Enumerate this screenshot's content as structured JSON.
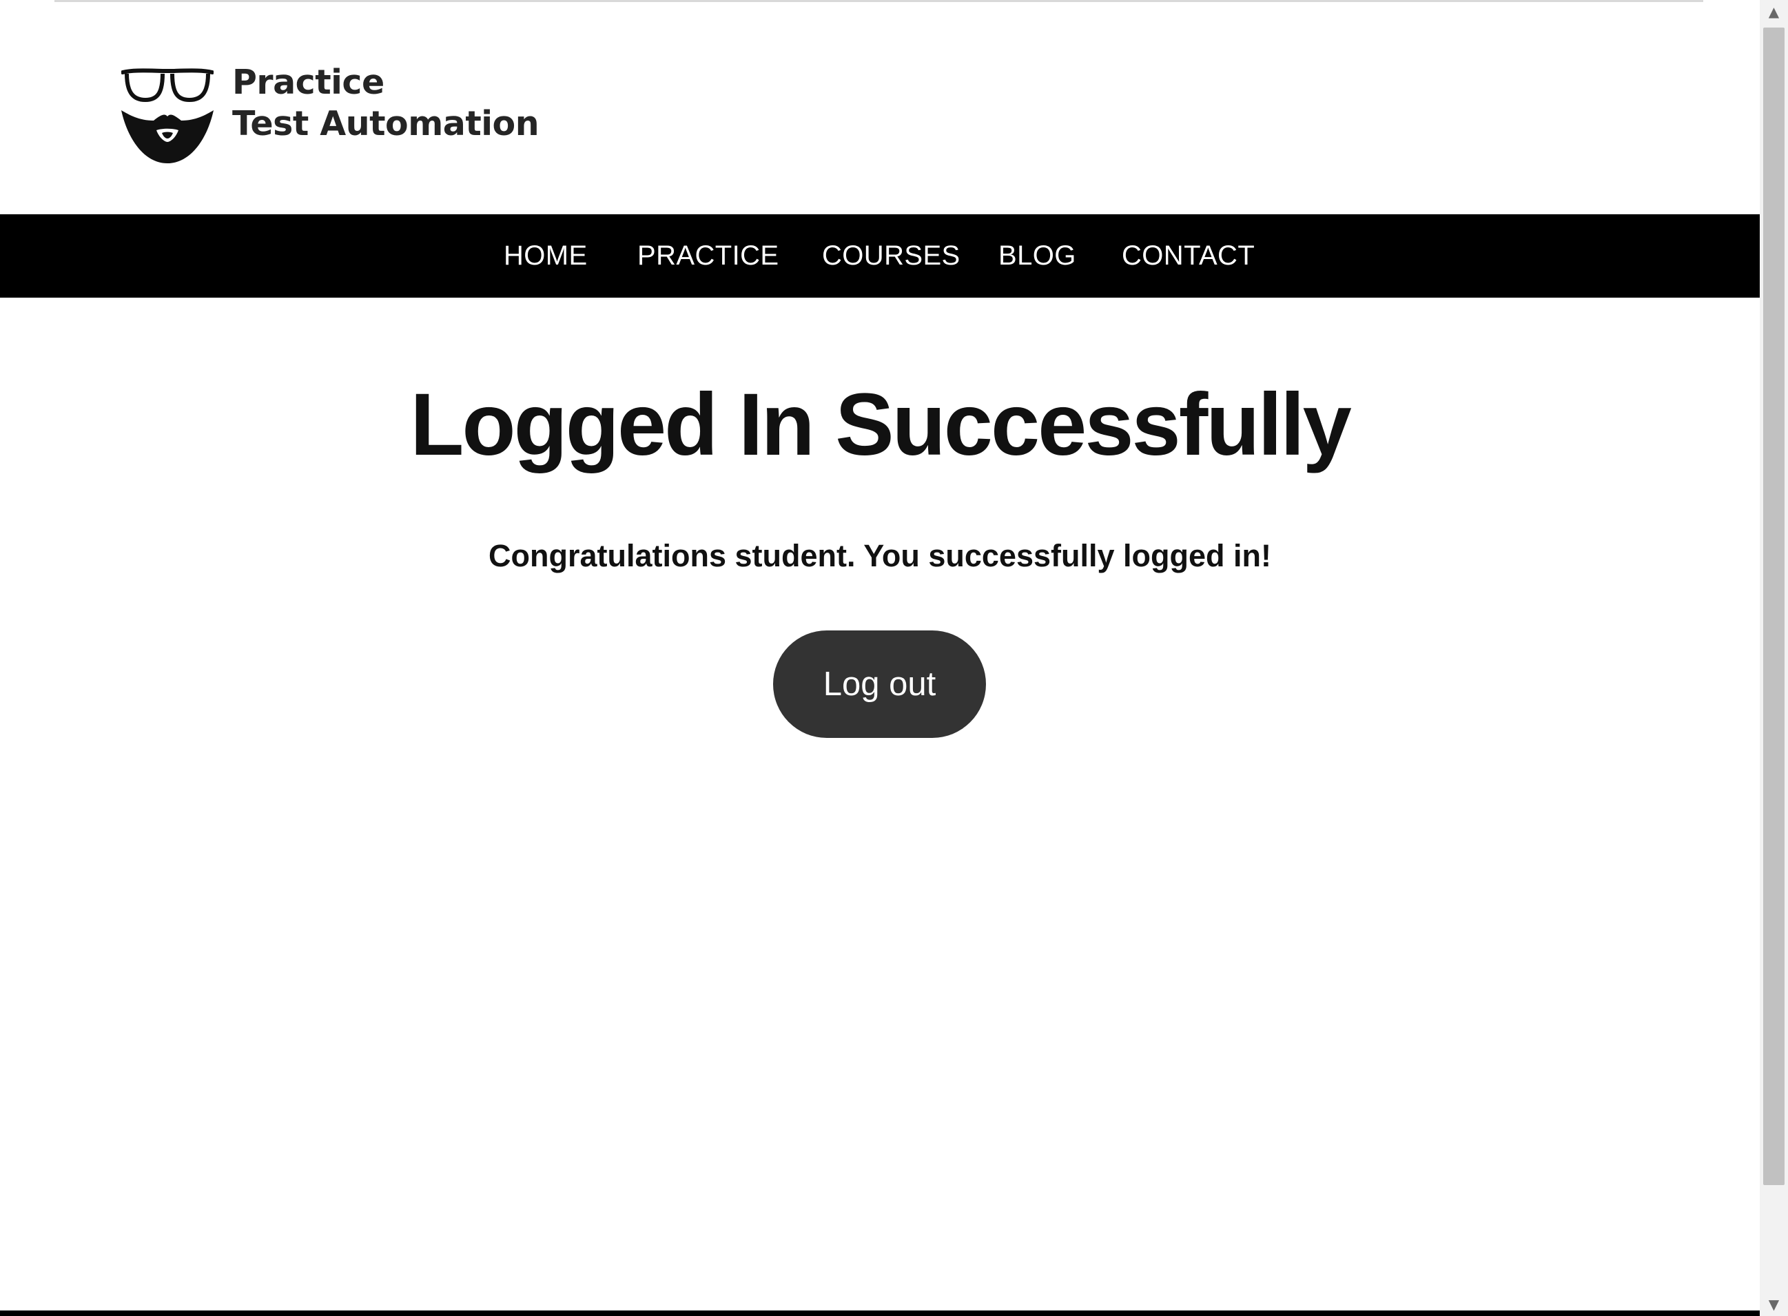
{
  "site": {
    "logo": {
      "line1": "Practice",
      "line2": "Test Automation",
      "glasses_icon": "glasses-icon",
      "beard_icon": "beard-icon"
    },
    "nav": {
      "items": [
        {
          "label": "HOME"
        },
        {
          "label": "PRACTICE"
        },
        {
          "label": "COURSES"
        },
        {
          "label": "BLOG"
        },
        {
          "label": "CONTACT"
        }
      ]
    }
  },
  "main": {
    "title": "Logged In Successfully",
    "message": "Congratulations student. You successfully logged in!",
    "logout_label": "Log out"
  },
  "scrollbar": {
    "up_icon": "chevron-up-icon",
    "down_icon": "chevron-down-icon"
  },
  "colors": {
    "page_background": "#ffffff",
    "nav_background": "#000000",
    "nav_text": "#ffffff",
    "heading_text": "#111111",
    "button_background": "#333333",
    "button_text": "#ffffff",
    "scrollbar_track": "#f2f2f2",
    "scrollbar_thumb": "#c1c1c1"
  }
}
